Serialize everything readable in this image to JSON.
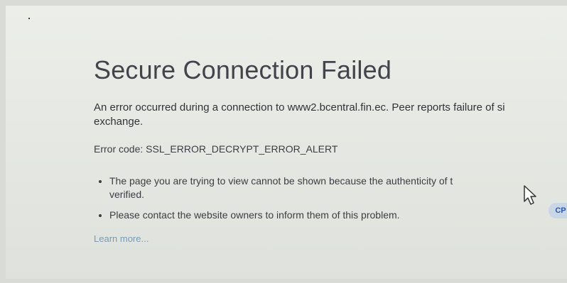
{
  "error_page": {
    "title": "Secure Connection Failed",
    "description": "An error occurred during a connection to www2.bcentral.fin.ec. Peer reports failure of si",
    "description_line2": "exchange.",
    "error_code": "Error code: SSL_ERROR_DECRYPT_ERROR_ALERT",
    "bullets": [
      "The page you are trying to view cannot be shown because the authenticity of t",
      "verified.",
      "Please contact the website owners to inform them of this problem."
    ],
    "learn_more": "Learn more..."
  },
  "overlay": {
    "badge_label": "CP",
    "cursor_icon": "mouse-pointer-icon"
  },
  "colors": {
    "background": "#e6e9e3",
    "text": "#3a3e44",
    "link": "#7a9bb4"
  }
}
